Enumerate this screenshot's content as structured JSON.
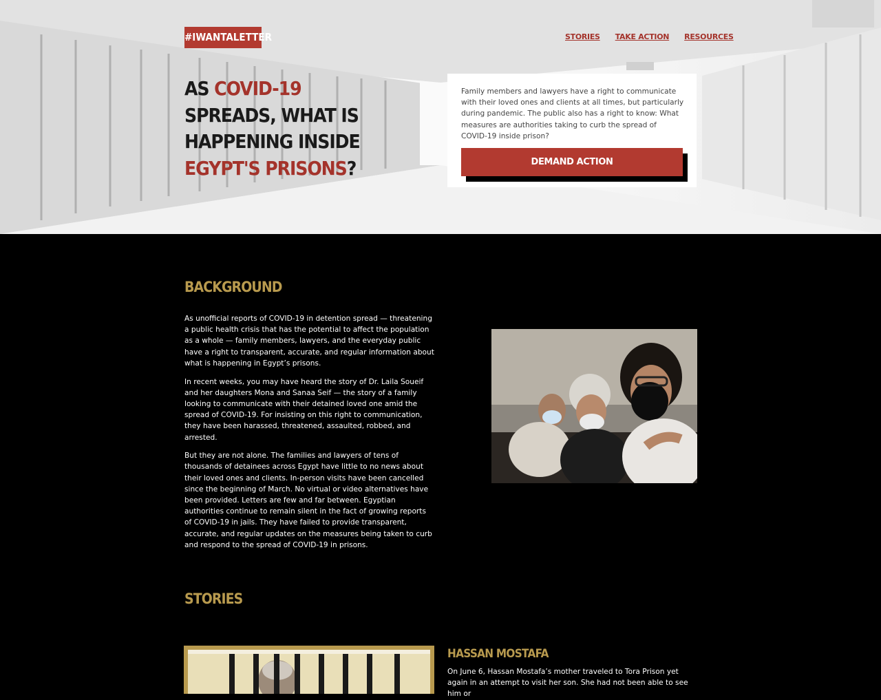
{
  "brand": "#IWANTALETTER",
  "nav": {
    "stories": "STORIES",
    "take_action": "TAKE ACTION",
    "resources": "RESOURCES"
  },
  "hero": {
    "h_part1": "AS ",
    "h_red1": "COVID-19",
    "h_part2": " SPREADS, WHAT IS HAPPENING INSIDE ",
    "h_red2": "EGYPT'S PRISONS",
    "h_part3": "?",
    "card_text": "Family members and lawyers have a right to communicate with their loved ones and clients at all times, but particularly during pandemic. The public also has a right to know: What measures are authorities taking to curb the spread of COVID-19 inside prison?",
    "cta_label": "DEMAND ACTION"
  },
  "background": {
    "title": "BACKGROUND",
    "paragraphs": [
      "As unofficial reports of COVID-19 in detention spread — threatening a public health crisis that has the potential to affect the population as a whole — family members, lawyers, and the everyday public have a right to transparent, accurate, and regular information about what is happening in Egypt’s prisons.",
      "In recent weeks, you may have heard the story of Dr. Laila Soueif and her daughters Mona and Sanaa Seif — the story of a family looking to communicate with their detained loved one amid the spread of COVID-19. For insisting on this right to communication, they have been harassed, threatened, assaulted, robbed, and arrested.",
      "But they are not alone. The families and lawyers of tens of thousands of detainees across Egypt have little to no news about their loved ones and clients. In-person visits have been cancelled since the beginning of March. No virtual or video alternatives have been provided. Letters are few and far between. Egyptian authorities continue to remain silent in the fact of growing reports of COVID-19 in jails. They have failed to provide transparent, accurate, and regular updates on the measures being taken to curb and respond to the spread of COVID-19 in prisons."
    ]
  },
  "stories": {
    "title": "STORIES",
    "first": {
      "name": "HASSAN MOSTAFA",
      "text": "On June 6, Hassan Mostafa’s mother traveled to Tora Prison yet again in an attempt to visit her son. She had not been able to see him or"
    }
  },
  "colors": {
    "accent_red": "#b23a30",
    "gold": "#b89a4e"
  }
}
